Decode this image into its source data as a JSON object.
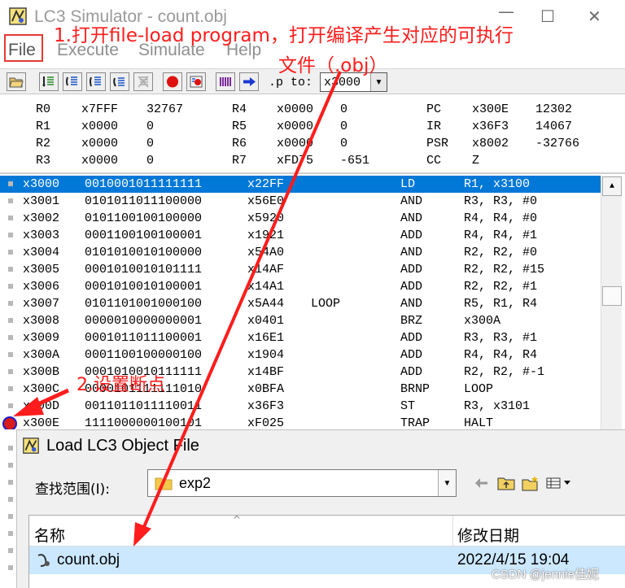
{
  "window": {
    "title": "LC3 Simulator - count.obj"
  },
  "menu": {
    "items": [
      "File",
      "Execute",
      "Simulate",
      "Help"
    ]
  },
  "toolbar": {
    "pc_label": ".p to:",
    "pc_value": "x3000"
  },
  "registers": [
    [
      {
        "name": "R0",
        "hex": "x7FFF",
        "dec": "32767"
      },
      {
        "name": "R4",
        "hex": "x0000",
        "dec": "0"
      },
      {
        "name": "PC",
        "hex": "x300E",
        "dec": "12302"
      }
    ],
    [
      {
        "name": "R1",
        "hex": "x0000",
        "dec": "0"
      },
      {
        "name": "R5",
        "hex": "x0000",
        "dec": "0"
      },
      {
        "name": "IR",
        "hex": "x36F3",
        "dec": "14067"
      }
    ],
    [
      {
        "name": "R2",
        "hex": "x0000",
        "dec": "0"
      },
      {
        "name": "R6",
        "hex": "x0000",
        "dec": "0"
      },
      {
        "name": "PSR",
        "hex": "x8002",
        "dec": "-32766"
      }
    ],
    [
      {
        "name": "R3",
        "hex": "x0000",
        "dec": "0"
      },
      {
        "name": "R7",
        "hex": "xFD75",
        "dec": "-651"
      },
      {
        "name": "CC",
        "hex": "Z",
        "dec": ""
      }
    ]
  ],
  "memory": [
    {
      "addr": "x3000",
      "bin": "0010001011111111",
      "hex": "x22FF",
      "label": "",
      "op": "LD",
      "args": "R1, x3100",
      "selected": true
    },
    {
      "addr": "x3001",
      "bin": "0101011011100000",
      "hex": "x56E0",
      "label": "",
      "op": "AND",
      "args": "R3, R3, #0"
    },
    {
      "addr": "x3002",
      "bin": "0101100100100000",
      "hex": "x5920",
      "label": "",
      "op": "AND",
      "args": "R4, R4, #0"
    },
    {
      "addr": "x3003",
      "bin": "0001100100100001",
      "hex": "x1921",
      "label": "",
      "op": "ADD",
      "args": "R4, R4, #1"
    },
    {
      "addr": "x3004",
      "bin": "0101010010100000",
      "hex": "x54A0",
      "label": "",
      "op": "AND",
      "args": "R2, R2, #0"
    },
    {
      "addr": "x3005",
      "bin": "0001010010101111",
      "hex": "x14AF",
      "label": "",
      "op": "ADD",
      "args": "R2, R2, #15"
    },
    {
      "addr": "x3006",
      "bin": "0001010010100001",
      "hex": "x14A1",
      "label": "",
      "op": "ADD",
      "args": "R2, R2, #1"
    },
    {
      "addr": "x3007",
      "bin": "0101101001000100",
      "hex": "x5A44",
      "label": "LOOP",
      "op": "AND",
      "args": "R5, R1, R4"
    },
    {
      "addr": "x3008",
      "bin": "0000010000000001",
      "hex": "x0401",
      "label": "",
      "op": "BRZ",
      "args": "x300A"
    },
    {
      "addr": "x3009",
      "bin": "0001011011100001",
      "hex": "x16E1",
      "label": "",
      "op": "ADD",
      "args": "R3, R3, #1"
    },
    {
      "addr": "x300A",
      "bin": "0001100100000100",
      "hex": "x1904",
      "label": "",
      "op": "ADD",
      "args": "R4, R4, R4"
    },
    {
      "addr": "x300B",
      "bin": "0001010010111111",
      "hex": "x14BF",
      "label": "",
      "op": "ADD",
      "args": "R2, R2, #-1"
    },
    {
      "addr": "x300C",
      "bin": "0000101111111010",
      "hex": "x0BFA",
      "label": "",
      "op": "BRNP",
      "args": "LOOP"
    },
    {
      "addr": "x300D",
      "bin": "0011011011110011",
      "hex": "x36F3",
      "label": "",
      "op": "ST",
      "args": "R3, x3101"
    },
    {
      "addr": "x300E",
      "bin": "1111000000100101",
      "hex": "xF025",
      "label": "",
      "op": "TRAP",
      "args": "HALT"
    }
  ],
  "dialog": {
    "title": "Load LC3 Object File",
    "look_in_label": "查找范围(I):",
    "look_in_value": "exp2",
    "col_name": "名称",
    "col_date": "修改日期",
    "files": [
      {
        "name": "count.obj",
        "date": "2022/4/15 19:04"
      }
    ]
  },
  "annotations": {
    "step1_line1": "1.打开file-load program，打开编译产生对应的可执行",
    "step1_line2": "文件（.obj）",
    "step2": "2.设置断点"
  },
  "watermark": "CSDN @jennie佳妮",
  "colors": {
    "annotation": "#ff1c1c",
    "selection": "#0078d7",
    "file_highlight": "#cce8ff"
  }
}
